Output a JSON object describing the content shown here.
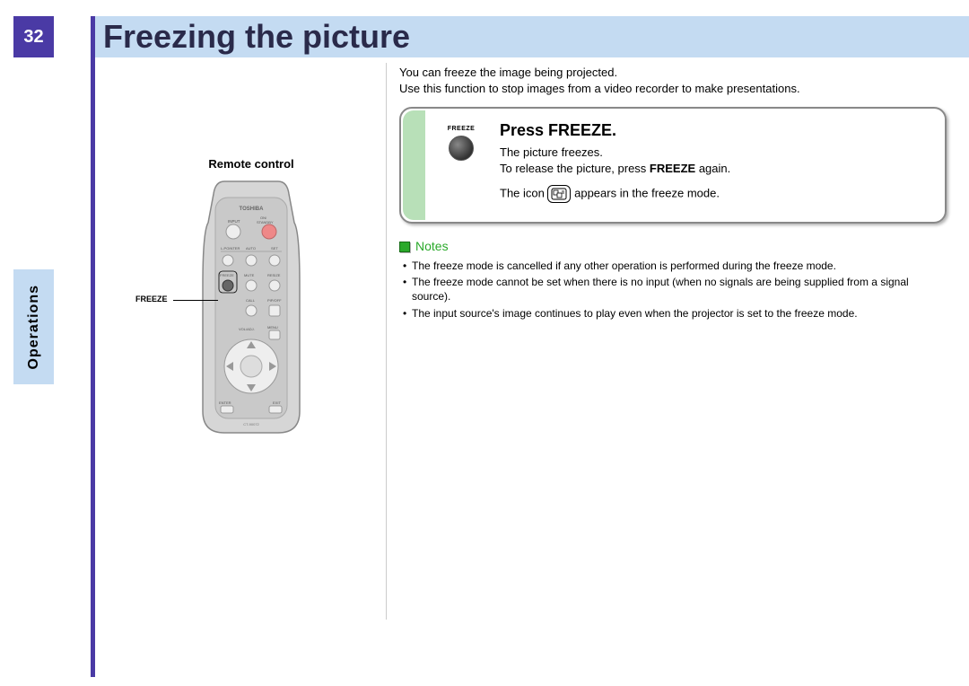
{
  "page_number": "32",
  "page_title": "Freezing the picture",
  "section_tab": "Operations",
  "left": {
    "remote_label": "Remote control",
    "freeze_callout": "FREEZE",
    "remote": {
      "brand": "TOSHIBA",
      "labels": {
        "input": "INPUT",
        "on_standby": "ON/\nSTANDBY",
        "lpointer": "L-POINTER",
        "auto": "AUTO",
        "set": "SET",
        "freeze": "FREEZE",
        "mute": "MUTE",
        "resize": "RESIZE",
        "call": "CALL",
        "pipoff": "PIP/OFF",
        "menu": "MENU",
        "voladj": "VOL/ADJ.",
        "enter": "ENTER",
        "exit": "EXIT",
        "model": "CT-90072"
      }
    }
  },
  "right": {
    "intro_line1": "You can freeze the image being projected.",
    "intro_line2": "Use this function to stop images from a video recorder to make presentations.",
    "instruction": {
      "key_label": "FREEZE",
      "title": "Press FREEZE.",
      "line1": "The picture freezes.",
      "line2_pre": "To release the picture, press ",
      "line2_bold": "FREEZE",
      "line2_post": " again.",
      "icon_line_pre": "The icon ",
      "icon_line_post": " appears in the freeze mode."
    },
    "notes_title": "Notes",
    "notes": [
      "The freeze mode is cancelled if any other operation is performed during the freeze mode.",
      "The freeze mode cannot be set when there is no input (when no signals are being supplied from a signal source).",
      "The input source's image continues to play even when the projector is set to the freeze mode."
    ]
  }
}
